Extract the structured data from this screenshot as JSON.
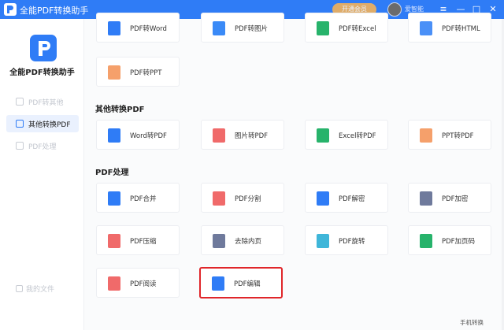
{
  "titlebar": {
    "title": "全能PDF转换助手",
    "vip_label": "开通会员",
    "username": "爱智能",
    "minimize": "—",
    "maximize": "□",
    "close": "✕",
    "menu": "≡"
  },
  "sidebar": {
    "app_name": "全能PDF转换助手",
    "items": [
      {
        "label": "PDF转其他"
      },
      {
        "label": "其他转换PDF"
      },
      {
        "label": "PDF处理"
      }
    ],
    "bottom_label": "我的文件"
  },
  "sections": {
    "other_to_pdf_title": "其他转换PDF",
    "pdf_process_title": "PDF处理"
  },
  "cards": {
    "pdf_to_word": "PDF转Word",
    "pdf_to_image": "PDF转图片",
    "pdf_to_excel": "PDF转Excel",
    "pdf_to_html": "PDF转HTML",
    "pdf_to_ppt": "PDF转PPT",
    "word_to_pdf": "Word转PDF",
    "image_to_pdf": "图片转PDF",
    "excel_to_pdf": "Excel转PDF",
    "ppt_to_pdf": "PPT转PDF",
    "pdf_merge": "PDF合并",
    "pdf_split": "PDF分割",
    "pdf_decrypt": "PDF解密",
    "pdf_encrypt": "PDF加密",
    "pdf_compress": "PDF压缩",
    "remove_pages": "去除内页",
    "pdf_rotate": "PDF旋转",
    "pdf_page_number": "PDF加页码",
    "pdf_read": "PDF阅读",
    "pdf_edit": "PDF编辑"
  },
  "footer": {
    "mobile_convert": "手机转换"
  },
  "colors": {
    "brand": "#2f7cf6",
    "highlight_border": "#e0262a"
  }
}
